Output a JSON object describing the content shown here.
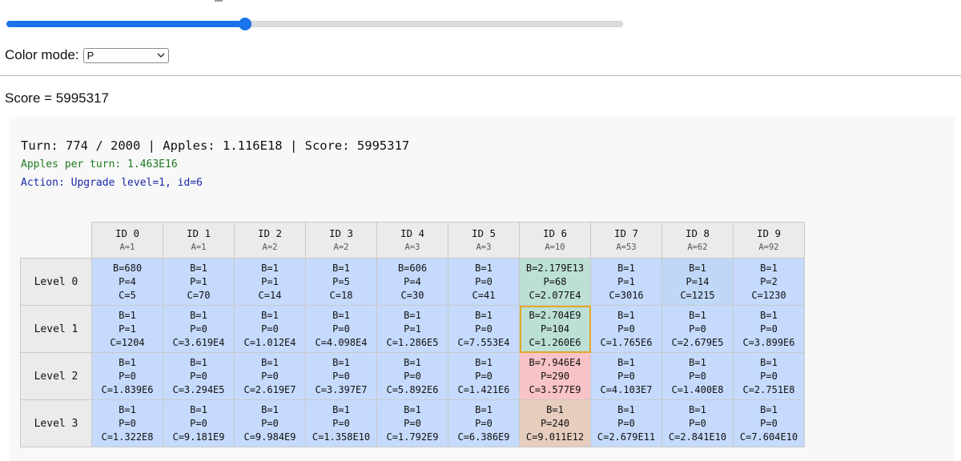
{
  "slider": {
    "value_fraction": 0.387
  },
  "color_mode": {
    "label": "Color mode:",
    "selected": "P"
  },
  "score_line": "Score = 5995317",
  "status": {
    "headline": "Turn: 774 / 2000 | Apples: 1.116E18 | Score: 5995317",
    "apples_per_turn": "Apples per turn: 1.463E16",
    "action": "Action: Upgrade level=1, id=6"
  },
  "colors": {
    "default_cell": "#c5dafc",
    "highlight_border": "#e0a92b",
    "apples_per_turn_text": "#1f7a1f",
    "action_text": "#1a2aa8",
    "slider_accent": "#1a73e8"
  },
  "grid": {
    "columns": [
      {
        "id": "ID 0",
        "a": "A=1"
      },
      {
        "id": "ID 1",
        "a": "A=1"
      },
      {
        "id": "ID 2",
        "a": "A=2"
      },
      {
        "id": "ID 3",
        "a": "A=2"
      },
      {
        "id": "ID 4",
        "a": "A=3"
      },
      {
        "id": "ID 5",
        "a": "A=3"
      },
      {
        "id": "ID 6",
        "a": "A=10"
      },
      {
        "id": "ID 7",
        "a": "A=53"
      },
      {
        "id": "ID 8",
        "a": "A=62"
      },
      {
        "id": "ID 9",
        "a": "A=92"
      }
    ],
    "rows": [
      {
        "label": "Level 0",
        "cells": [
          {
            "b": "B=680",
            "p": "P=4",
            "c": "C=5"
          },
          {
            "b": "B=1",
            "p": "P=1",
            "c": "C=70"
          },
          {
            "b": "B=1",
            "p": "P=1",
            "c": "C=14"
          },
          {
            "b": "B=1",
            "p": "P=5",
            "c": "C=18"
          },
          {
            "b": "B=606",
            "p": "P=4",
            "c": "C=30"
          },
          {
            "b": "B=1",
            "p": "P=0",
            "c": "C=41"
          },
          {
            "b": "B=2.179E13",
            "p": "P=68",
            "c": "C=2.077E4",
            "color": "#bcdfd6"
          },
          {
            "b": "B=1",
            "p": "P=1",
            "c": "C=3016"
          },
          {
            "b": "B=1",
            "p": "P=14",
            "c": "C=1215",
            "color": "#c0d8f7"
          },
          {
            "b": "B=1",
            "p": "P=2",
            "c": "C=1230"
          }
        ]
      },
      {
        "label": "Level 1",
        "cells": [
          {
            "b": "B=1",
            "p": "P=1",
            "c": "C=1204"
          },
          {
            "b": "B=1",
            "p": "P=0",
            "c": "C=3.619E4"
          },
          {
            "b": "B=1",
            "p": "P=0",
            "c": "C=1.012E4"
          },
          {
            "b": "B=1",
            "p": "P=0",
            "c": "C=4.098E4"
          },
          {
            "b": "B=1",
            "p": "P=1",
            "c": "C=1.286E5"
          },
          {
            "b": "B=1",
            "p": "P=0",
            "c": "C=7.553E4"
          },
          {
            "b": "B=2.704E9",
            "p": "P=104",
            "c": "C=1.260E6",
            "color": "#bcdfd6",
            "highlight": true
          },
          {
            "b": "B=1",
            "p": "P=0",
            "c": "C=1.765E6"
          },
          {
            "b": "B=1",
            "p": "P=0",
            "c": "C=2.679E5"
          },
          {
            "b": "B=1",
            "p": "P=0",
            "c": "C=3.899E6"
          }
        ]
      },
      {
        "label": "Level 2",
        "cells": [
          {
            "b": "B=1",
            "p": "P=0",
            "c": "C=1.839E6"
          },
          {
            "b": "B=1",
            "p": "P=0",
            "c": "C=3.294E5"
          },
          {
            "b": "B=1",
            "p": "P=0",
            "c": "C=2.619E7"
          },
          {
            "b": "B=1",
            "p": "P=0",
            "c": "C=3.397E7"
          },
          {
            "b": "B=1",
            "p": "P=0",
            "c": "C=5.892E6"
          },
          {
            "b": "B=1",
            "p": "P=0",
            "c": "C=1.421E6"
          },
          {
            "b": "B=7.946E4",
            "p": "P=290",
            "c": "C=3.577E9",
            "color": "#f8c3c6"
          },
          {
            "b": "B=1",
            "p": "P=0",
            "c": "C=4.103E7"
          },
          {
            "b": "B=1",
            "p": "P=0",
            "c": "C=1.400E8"
          },
          {
            "b": "B=1",
            "p": "P=0",
            "c": "C=2.751E8"
          }
        ]
      },
      {
        "label": "Level 3",
        "cells": [
          {
            "b": "B=1",
            "p": "P=0",
            "c": "C=1.322E8"
          },
          {
            "b": "B=1",
            "p": "P=0",
            "c": "C=9.181E9"
          },
          {
            "b": "B=1",
            "p": "P=0",
            "c": "C=9.984E9"
          },
          {
            "b": "B=1",
            "p": "P=0",
            "c": "C=1.358E10"
          },
          {
            "b": "B=1",
            "p": "P=0",
            "c": "C=1.792E9"
          },
          {
            "b": "B=1",
            "p": "P=0",
            "c": "C=6.386E9"
          },
          {
            "b": "B=1",
            "p": "P=240",
            "c": "C=9.011E12",
            "color": "#e6cdbd"
          },
          {
            "b": "B=1",
            "p": "P=0",
            "c": "C=2.679E11"
          },
          {
            "b": "B=1",
            "p": "P=0",
            "c": "C=2.841E10"
          },
          {
            "b": "B=1",
            "p": "P=0",
            "c": "C=7.604E10"
          }
        ]
      }
    ]
  }
}
